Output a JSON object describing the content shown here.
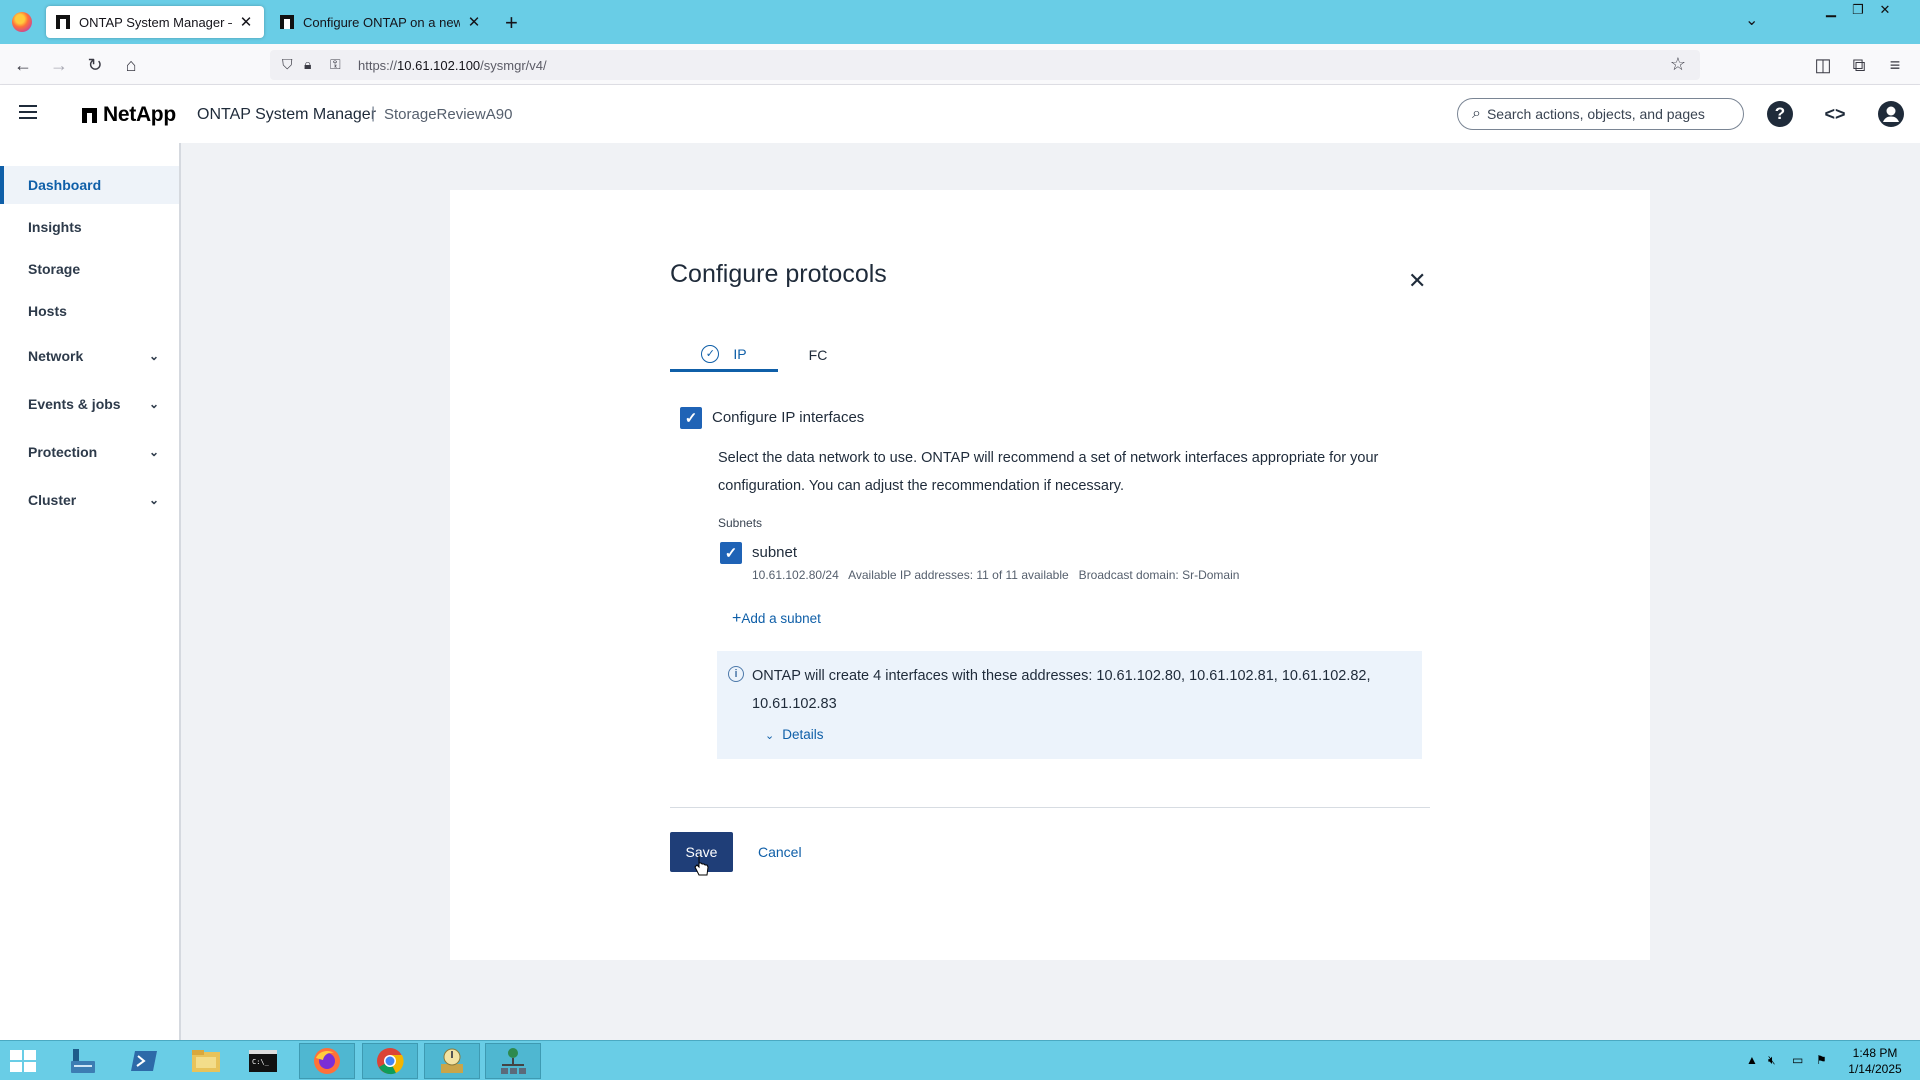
{
  "browser": {
    "tabs": [
      {
        "title": "ONTAP System Manager — Da",
        "active": true
      },
      {
        "title": "Configure ONTAP on a new clu",
        "active": false
      }
    ],
    "url_prefix": "https://",
    "url_host": "10.61.102.100",
    "url_path": "/sysmgr/v4/"
  },
  "header": {
    "brand": "NetApp",
    "app_title": "ONTAP System Manager",
    "separator": "|",
    "cluster": "StorageReviewA90",
    "search_placeholder": "Search actions, objects, and pages",
    "help_icon": "?"
  },
  "sidebar": {
    "items": [
      {
        "label": "Dashboard",
        "active": true,
        "expandable": false
      },
      {
        "label": "Insights",
        "active": false,
        "expandable": false
      },
      {
        "label": "Storage",
        "active": false,
        "expandable": false
      },
      {
        "label": "Hosts",
        "active": false,
        "expandable": false
      },
      {
        "label": "Network",
        "active": false,
        "expandable": true
      },
      {
        "label": "Events & jobs",
        "active": false,
        "expandable": true
      },
      {
        "label": "Protection",
        "active": false,
        "expandable": true
      },
      {
        "label": "Cluster",
        "active": false,
        "expandable": true
      }
    ]
  },
  "dialog": {
    "title": "Configure protocols",
    "tabs": [
      {
        "label": "IP",
        "active": true,
        "completed": true
      },
      {
        "label": "FC",
        "active": false,
        "completed": false
      }
    ],
    "configure_ip_label": "Configure IP interfaces",
    "configure_ip_checked": true,
    "description_line1": "Select the data network to use. ONTAP will recommend a set of network interfaces appropriate for your",
    "description_line2": "configuration. You can adjust the recommendation if necessary.",
    "subnets_heading": "Subnets",
    "subnet": {
      "name": "subnet",
      "checked": true,
      "details": "10.61.102.80/24   Available IP addresses: 11 of 11 available   Broadcast domain: Sr-Domain"
    },
    "add_subnet_label": "Add a subnet",
    "info_line1": "ONTAP will create 4 interfaces with these addresses: 10.61.102.80, 10.61.102.81, 10.61.102.82,",
    "info_line2": "10.61.102.83",
    "details_label": "Details",
    "save_label": "Save",
    "cancel_label": "Cancel"
  },
  "taskbar": {
    "time": "1:48 PM",
    "date": "1/14/2025"
  },
  "colors": {
    "accent": "#0f5fa8",
    "save_button": "#1f3e78",
    "checkbox": "#1f63b6",
    "info_bg": "#ecf3fb",
    "chrome": "#69cde6"
  }
}
